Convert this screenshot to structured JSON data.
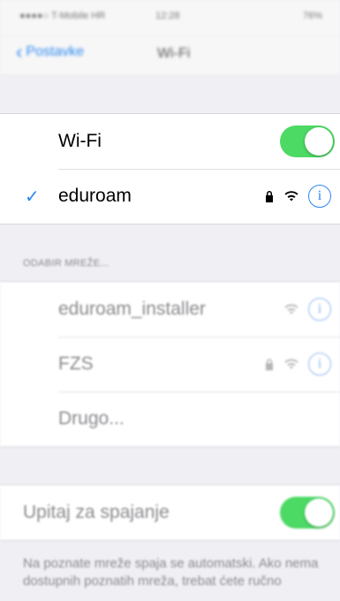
{
  "status_bar": {
    "carrier": "●●●●○ T-Mobile HR",
    "time": "12:28",
    "battery": "76%"
  },
  "nav": {
    "back_label": "Postavke",
    "title": "Wi-Fi"
  },
  "wifi_toggle": {
    "label": "Wi-Fi",
    "on": true
  },
  "connected_network": {
    "name": "eduroam",
    "secured": true,
    "info_label": "i"
  },
  "section_header": "ODABIR MREŽE...",
  "networks": [
    {
      "name": "eduroam_installer",
      "secured": false,
      "info_label": "i"
    },
    {
      "name": "FZS",
      "secured": true,
      "info_label": "i"
    }
  ],
  "other_label": "Drugo...",
  "ask_to_join": {
    "label": "Upitaj za spajanje",
    "on": true
  },
  "footer_text": "Na poznate mreže spaja se automatski. Ako nema dostupnih poznatih mreža, trebat ćete ručno",
  "colors": {
    "accent": "#2c87f0",
    "toggle_on": "#4cd964",
    "background": "#efeff4"
  }
}
